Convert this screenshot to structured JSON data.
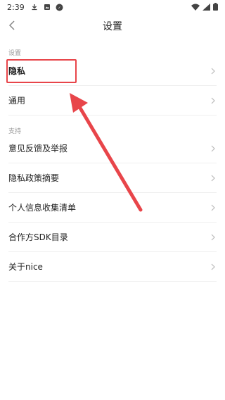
{
  "status_bar": {
    "time": "2:39",
    "icons": [
      "download-icon",
      "image-icon",
      "notification-icon",
      "wifi-icon",
      "signal-icon",
      "battery-icon"
    ]
  },
  "header": {
    "title": "设置"
  },
  "sections": [
    {
      "label": "设置",
      "items": [
        {
          "label": "隐私"
        },
        {
          "label": "通用"
        }
      ]
    },
    {
      "label": "支持",
      "items": [
        {
          "label": "意见反馈及举报"
        },
        {
          "label": "隐私政策摘要"
        },
        {
          "label": "个人信息收集清单"
        },
        {
          "label": "合作方SDK目录"
        },
        {
          "label": "关于nice"
        }
      ]
    }
  ],
  "colors": {
    "annotation": "#e8454a",
    "divider": "#efefef",
    "section_label": "#999999"
  }
}
